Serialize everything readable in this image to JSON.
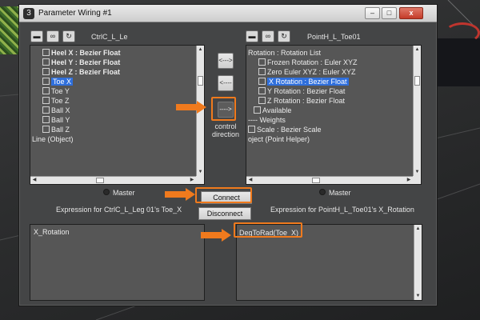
{
  "window": {
    "title": "Parameter Wiring #1",
    "min_label": "–",
    "max_label": "□",
    "close_label": "x"
  },
  "left": {
    "node_title": "CtrlC_L_Le",
    "tree": [
      {
        "label": "Heel X : Bezier Float",
        "bold": true,
        "selected": false,
        "box": true
      },
      {
        "label": "Heel Y : Bezier Float",
        "bold": true,
        "selected": false,
        "box": true
      },
      {
        "label": "Heel Z : Bezier Float",
        "bold": true,
        "selected": false,
        "box": true
      },
      {
        "label": "Toe X",
        "bold": false,
        "selected": true,
        "box": true
      },
      {
        "label": "Toe Y",
        "bold": false,
        "selected": false,
        "box": true
      },
      {
        "label": "Toe Z",
        "bold": false,
        "selected": false,
        "box": true
      },
      {
        "label": "Ball X",
        "bold": false,
        "selected": false,
        "box": true
      },
      {
        "label": "Ball Y",
        "bold": false,
        "selected": false,
        "box": true
      },
      {
        "label": "Ball Z",
        "bold": false,
        "selected": false,
        "box": true
      },
      {
        "label": "Line (Object)",
        "bold": false,
        "selected": false,
        "box": false
      }
    ],
    "master_label": "Master",
    "expression_label": "Expression for CtrlC_L_Leg 01's Toe_X",
    "expression_value": "X_Rotation"
  },
  "right": {
    "node_title": "PointH_L_Toe01",
    "tree": [
      {
        "label": "Rotation : Rotation List",
        "bold": false,
        "selected": false,
        "box": false
      },
      {
        "label": "Frozen Rotation : Euler XYZ",
        "bold": false,
        "selected": false,
        "box": true
      },
      {
        "label": "Zero Euler XYZ : Euler XYZ",
        "bold": false,
        "selected": false,
        "box": true
      },
      {
        "label": "X Rotation : Bezier Float",
        "bold": false,
        "selected": true,
        "box": true
      },
      {
        "label": "Y Rotation : Bezier Float",
        "bold": false,
        "selected": false,
        "box": true
      },
      {
        "label": "Z Rotation : Bezier Float",
        "bold": false,
        "selected": false,
        "box": true
      },
      {
        "label": "Available",
        "bold": false,
        "selected": false,
        "box": true
      },
      {
        "label": "---- Weights",
        "bold": false,
        "selected": false,
        "box": false
      },
      {
        "label": "Scale : Bezier Scale",
        "bold": false,
        "selected": false,
        "box": true
      },
      {
        "label": "oject (Point Helper)",
        "bold": false,
        "selected": false,
        "box": false
      }
    ],
    "master_label": "Master",
    "expression_label": "Expression for PointH_L_Toe01's X_Rotation",
    "expression_value": "DegToRad(Toe_X)"
  },
  "direction": {
    "both_label": "<--->",
    "left_label": "<----",
    "right_label": "---->",
    "caption": [
      "control",
      "direction"
    ]
  },
  "actions": {
    "connect_label": "Connect",
    "disconnect_label": "Disconnect"
  },
  "colors": {
    "annotation": "#f07a1d",
    "selection": "#2f6fdc"
  }
}
